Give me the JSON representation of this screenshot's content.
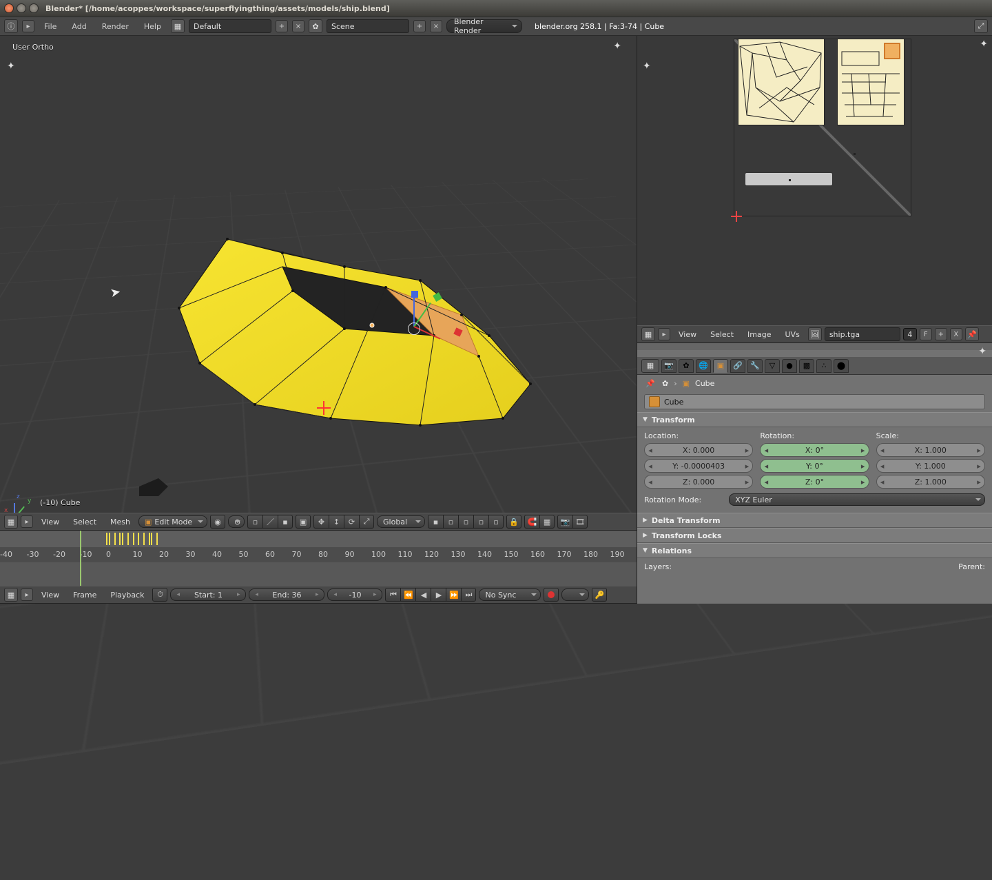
{
  "window": {
    "title": "Blender* [/home/acoppes/workspace/superflyingthing/assets/models/ship.blend]"
  },
  "info_header": {
    "menus": [
      "File",
      "Add",
      "Render",
      "Help"
    ],
    "layout": "Default",
    "scene": "Scene",
    "engine": "Blender Render",
    "stats": "blender.org 258.1 | Fa:3-74 | Cube"
  },
  "view3d": {
    "projection": "User Ortho",
    "object": "(-10) Cube",
    "menus": [
      "View",
      "Select",
      "Mesh"
    ],
    "mode": "Edit Mode",
    "orientation": "Global"
  },
  "uv": {
    "menus": [
      "View",
      "Select",
      "Image",
      "UVs"
    ],
    "image_name": "ship.tga",
    "channel": "4",
    "buttons": [
      "F",
      "+",
      "X"
    ]
  },
  "properties": {
    "object_name": "Cube",
    "transform_label": "Transform",
    "location_label": "Location:",
    "rotation_label": "Rotation:",
    "scale_label": "Scale:",
    "location": {
      "x": "X: 0.000",
      "y": "Y: -0.0000403",
      "z": "Z: 0.000"
    },
    "rotation": {
      "x": "X: 0°",
      "y": "Y: 0°",
      "z": "Z: 0°"
    },
    "scale": {
      "x": "X: 1.000",
      "y": "Y: 1.000",
      "z": "Z: 1.000"
    },
    "rotation_mode_label": "Rotation Mode:",
    "rotation_mode": "XYZ Euler",
    "delta_label": "Delta Transform",
    "locks_label": "Transform Locks",
    "relations_label": "Relations",
    "layers_label": "Layers:",
    "parent_label": "Parent:"
  },
  "timeline": {
    "menus": [
      "View",
      "Frame",
      "Playback"
    ],
    "start_label": "Start: 1",
    "end_label": "End: 36",
    "current": "-10",
    "sync": "No Sync",
    "ruler_start": -40,
    "ruler_step": 10,
    "ruler_count": 24,
    "keys": [
      0,
      1,
      3,
      5,
      6,
      8,
      10,
      12,
      14,
      16,
      17,
      19
    ],
    "playhead_frame": -10
  }
}
